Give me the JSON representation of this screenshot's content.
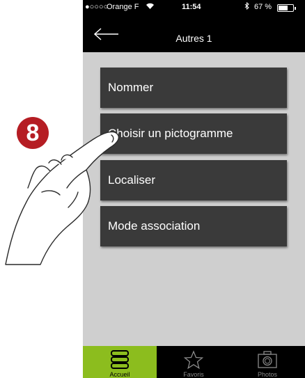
{
  "status_bar": {
    "signal": "●○○○○",
    "carrier": "Orange F",
    "wifi_icon": "wifi-icon",
    "time": "11:54",
    "bluetooth_icon": "bluetooth-icon",
    "battery": "67 %"
  },
  "nav": {
    "back_icon": "arrow-left-icon",
    "title": "Autres 1"
  },
  "menu": {
    "items": [
      {
        "label": "Nommer"
      },
      {
        "label": "Choisir un pictogramme"
      },
      {
        "label": "Localiser"
      },
      {
        "label": "Mode association"
      }
    ]
  },
  "tabs": [
    {
      "label": "Accueil",
      "icon": "home-stack-icon",
      "active": true
    },
    {
      "label": "Favoris",
      "icon": "star-icon",
      "active": false
    },
    {
      "label": "Photos",
      "icon": "camera-icon",
      "active": false
    }
  ],
  "annotation": {
    "step": "8"
  },
  "colors": {
    "active_tab": "#8cbd1e",
    "button_bg": "#3a3a3a",
    "content_bg": "#cfcfcf",
    "badge": "#b51d23"
  }
}
